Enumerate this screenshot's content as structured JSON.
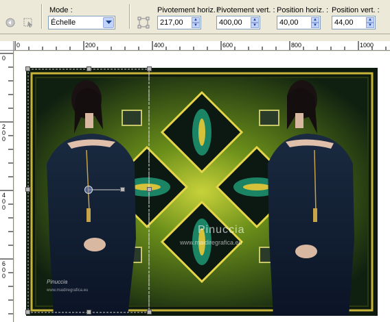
{
  "toolbar": {
    "mode_label": "Mode :",
    "mode_value": "Échelle",
    "rot_h_label": "Pivotement horiz. :",
    "rot_h_value": "217,00",
    "rot_v_label": "Pivotement vert. :",
    "rot_v_value": "400,00",
    "pos_h_label": "Position horiz. :",
    "pos_h_value": "40,00",
    "pos_v_label": "Position vert. :",
    "pos_v_value": "44,00"
  },
  "ruler": {
    "top_ticks": [
      "0",
      "200",
      "400",
      "600",
      "800",
      "1000"
    ],
    "left_ticks": [
      "0",
      "200",
      "400",
      "600"
    ]
  },
  "image": {
    "watermark_name": "Pinuccia",
    "watermark_url": "www.maidiregrafica.eu",
    "signature_name": "Pinuccia",
    "signature_url": "www.maidiregrafica.eu"
  },
  "colors": {
    "art_dark": "#0d1a0d",
    "art_green": "#6b8f1a",
    "art_yellow": "#d4d23a",
    "top_blue": "#c1d3fb"
  }
}
